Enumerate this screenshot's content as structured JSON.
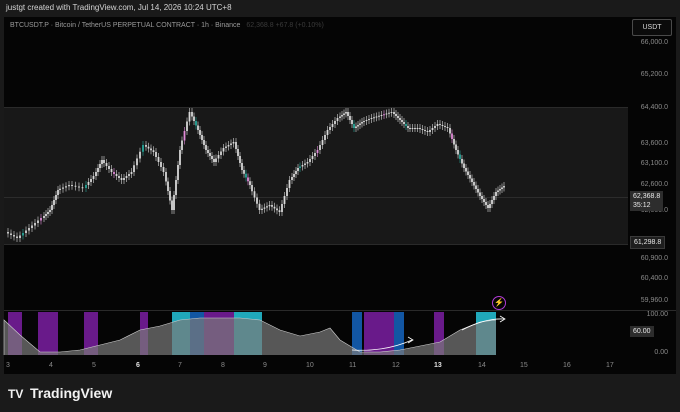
{
  "header": {
    "credit": "justgt created with TradingView.com, Jul 14, 2026 10:24 UTC+8"
  },
  "chart": {
    "symbol_line": "BTCUSDT.P · Bitcoin / TetherUS PERPETUAL CONTRACT · 1h · Binance",
    "ohlc_faint": "62,368.8 +67.8 (+0.10%)",
    "currency_button": "USDT",
    "price_axis": [
      "66,000.0",
      "65,200.0",
      "64,400.0",
      "63,600.0",
      "63,100.0",
      "62,600.0",
      "62,000.0",
      "60,900.0",
      "60,400.0",
      "59,960.0"
    ],
    "current_price": "62,368.8",
    "countdown": "35:12",
    "range_low_tag": "61,298.8",
    "oscillator_axis": [
      "100.00",
      "0.00"
    ],
    "oscillator_value": "60.00",
    "x_axis": [
      {
        "label": "3",
        "bold": false
      },
      {
        "label": "4",
        "bold": false
      },
      {
        "label": "5",
        "bold": false
      },
      {
        "label": "6",
        "bold": true
      },
      {
        "label": "7",
        "bold": false
      },
      {
        "label": "8",
        "bold": false
      },
      {
        "label": "9",
        "bold": false
      },
      {
        "label": "10",
        "bold": false
      },
      {
        "label": "11",
        "bold": false
      },
      {
        "label": "12",
        "bold": false
      },
      {
        "label": "13",
        "bold": true
      },
      {
        "label": "14",
        "bold": false
      },
      {
        "label": "15",
        "bold": false
      },
      {
        "label": "16",
        "bold": false
      },
      {
        "label": "17",
        "bold": false
      }
    ],
    "alert_icon": "lightning-icon",
    "colors": {
      "candle": "#d8d8d8",
      "candle_teal": "#26a69a",
      "candle_pink": "#e08ad8",
      "osc_purple": "#7b1fa2",
      "osc_blue": "#1565c0",
      "osc_cyan": "#26c6da",
      "osc_gray": "#7a7a7a",
      "accent": "#b13cd6"
    }
  },
  "footer": {
    "logo_mark": "TV",
    "brand": "TradingView"
  }
}
